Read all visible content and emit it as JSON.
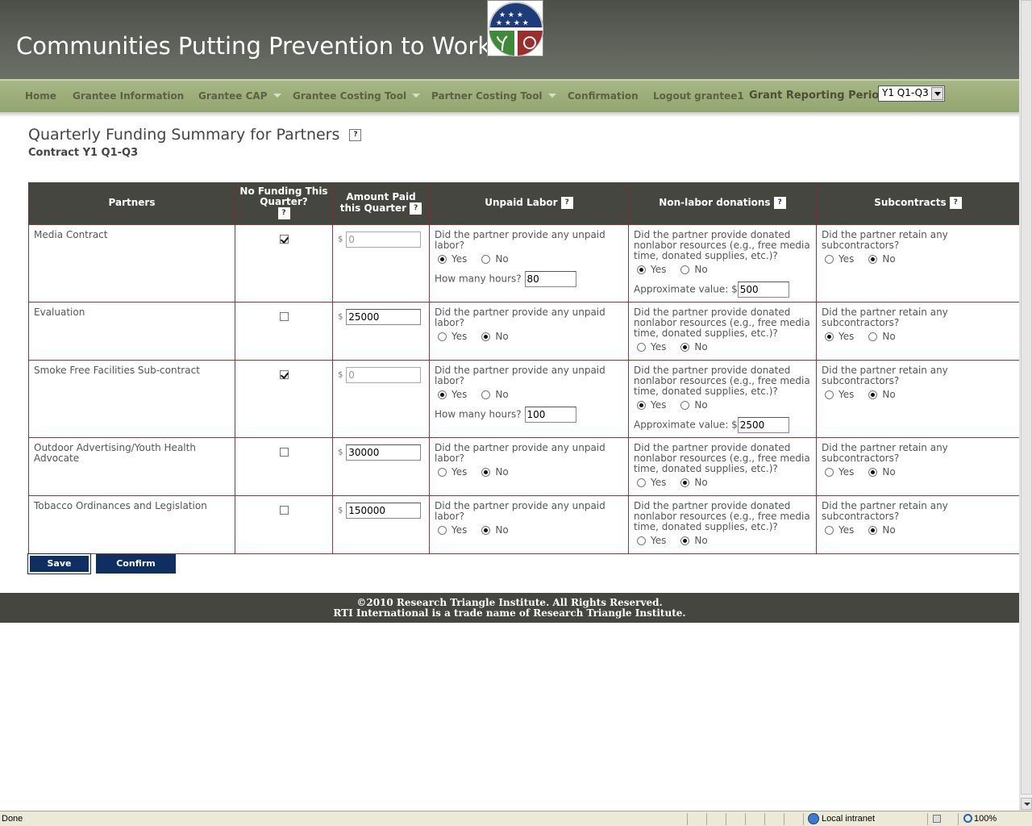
{
  "header": {
    "title": "Communities Putting Prevention to Work"
  },
  "nav": {
    "items": [
      {
        "label": "Home",
        "dropdown": false
      },
      {
        "label": "Grantee Information",
        "dropdown": false
      },
      {
        "label": "Grantee CAP",
        "dropdown": true
      },
      {
        "label": "Grantee Costing Tool",
        "dropdown": true
      },
      {
        "label": "Partner Costing Tool",
        "dropdown": true
      },
      {
        "label": "Confirmation",
        "dropdown": false
      },
      {
        "label": "Logout grantee1",
        "dropdown": false
      }
    ],
    "period_label": "Grant Reporting Period:",
    "period_value": "Y1 Q1-Q3"
  },
  "page": {
    "title": "Quarterly Funding Summary for Partners",
    "subtitle": "Contract Y1 Q1-Q3",
    "help_glyph": "?"
  },
  "table": {
    "headers": {
      "partners": "Partners",
      "no_funding": "No Funding This Quarter?",
      "amount": "Amount Paid this Quarter",
      "unpaid": "Unpaid Labor",
      "nonlabor": "Non-labor donations",
      "subcontracts": "Subcontracts"
    },
    "labels": {
      "currency": "$",
      "unpaid_q": "Did the partner provide any unpaid labor?",
      "nonlabor_q": "Did the partner provide donated nonlabor resources (e.g., free media time, donated supplies, etc.)?",
      "sub_q": "Did the partner retain any subcontractors?",
      "yes": "Yes",
      "no": "No",
      "hours_label": "How many hours?",
      "value_label": "Approximate value: $"
    },
    "rows": [
      {
        "partner": "Media Contract",
        "no_funding": true,
        "amount": "0",
        "unpaid": "yes",
        "hours": "80",
        "nonlabor": "yes",
        "value": "500",
        "sub": "no"
      },
      {
        "partner": "Evaluation",
        "no_funding": false,
        "amount": "25000",
        "unpaid": "no",
        "hours": "",
        "nonlabor": "no",
        "value": "",
        "sub": "yes"
      },
      {
        "partner": "Smoke Free Facilities Sub-contract",
        "no_funding": true,
        "amount": "0",
        "unpaid": "yes",
        "hours": "100",
        "nonlabor": "yes",
        "value": "2500",
        "sub": "no"
      },
      {
        "partner": "Outdoor Advertising/Youth Health Advocate",
        "no_funding": false,
        "amount": "30000",
        "unpaid": "no",
        "hours": "",
        "nonlabor": "no",
        "value": "",
        "sub": "no"
      },
      {
        "partner": "Tobacco Ordinances and Legislation",
        "no_funding": false,
        "amount": "150000",
        "unpaid": "no",
        "hours": "",
        "nonlabor": "no",
        "value": "",
        "sub": "no"
      }
    ]
  },
  "buttons": {
    "save": "Save",
    "confirm": "Confirm"
  },
  "footer": {
    "line1": "©2010 Research Triangle Institute. All Rights Reserved.",
    "line2": "RTI International is a trade name of Research Triangle Institute."
  },
  "statusbar": {
    "status": "Done",
    "zone": "Local intranet",
    "zoom": "100%"
  },
  "icons": {
    "seal": "recovery-seal-icon",
    "help": "help-icon",
    "caret": "chevron-down-icon"
  },
  "colors": {
    "header_bg": "#4b4f48",
    "nav_bg": "#a7b785",
    "table_header_bg": "#45463f",
    "button_bg": "#0f2f63",
    "footer_bg": "#45463f"
  }
}
